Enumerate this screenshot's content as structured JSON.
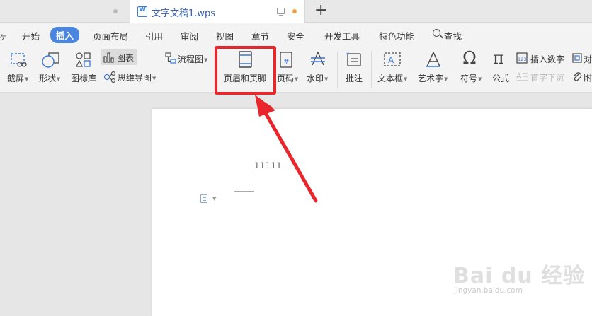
{
  "tabs": {
    "document_title": "文字文稿1.wps",
    "add_label": "+"
  },
  "menu": {
    "partial_first": "ヶ",
    "items": [
      "开始",
      "插入",
      "页面布局",
      "引用",
      "审阅",
      "视图",
      "章节",
      "安全",
      "开发工具",
      "特色功能"
    ],
    "active": "插入",
    "search_label": "查找"
  },
  "ribbon": {
    "screenshot": "截屏",
    "shapes": "形状",
    "icon_library": "图标库",
    "chart": "图表",
    "flowchart": "流程图",
    "mindmap": "思维导图",
    "header_footer": "页眉和页脚",
    "page_number": "页码",
    "watermark": "水印",
    "comment": "批注",
    "textbox": "文本框",
    "wordart": "艺术字",
    "symbol": "符号",
    "formula": "公式",
    "insert_number": "插入数字",
    "drop_cap": "首字下沉",
    "object_partial": "对",
    "attachment_partial": "附"
  },
  "document": {
    "content": "11111"
  },
  "watermark": {
    "main": "Bai du 经验",
    "sub": "jingyan.baidu.com"
  },
  "colors": {
    "highlight": "#e8262c",
    "accent": "#4a86e0"
  }
}
